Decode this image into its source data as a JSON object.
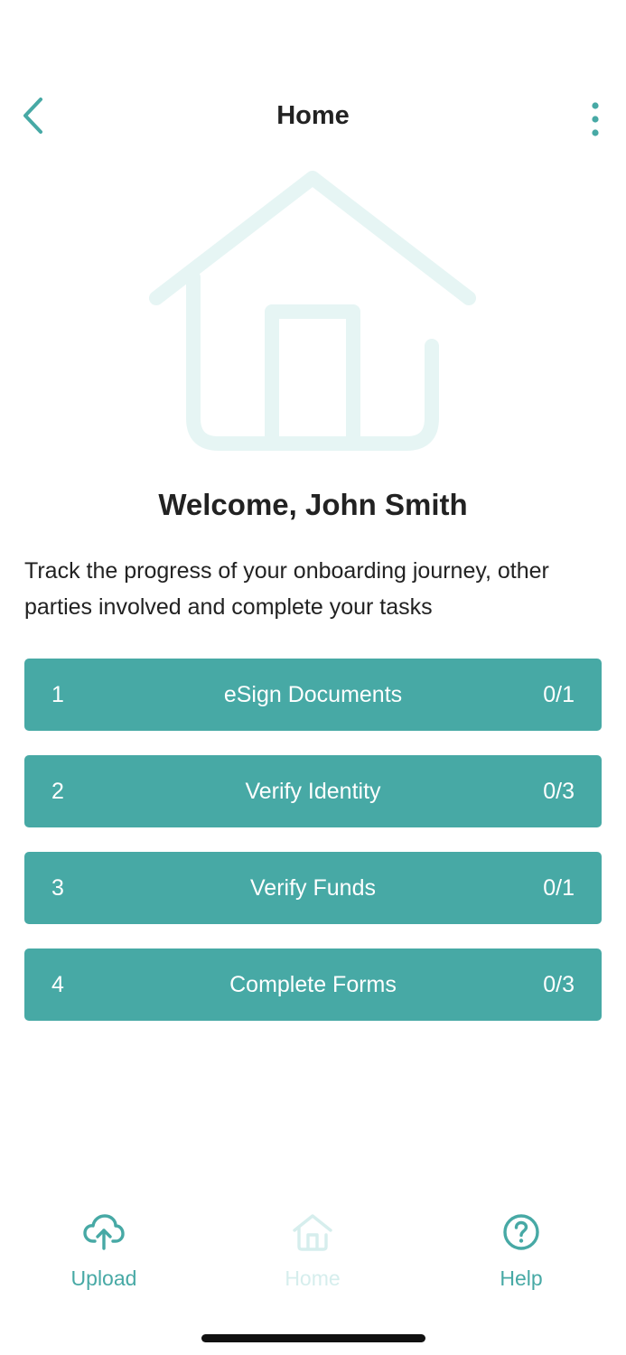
{
  "header": {
    "title": "Home",
    "back_icon": "chevron-left-icon",
    "more_icon": "more-vertical-icon"
  },
  "hero": {
    "icon": "house-illustration"
  },
  "welcome": {
    "title": "Welcome, John Smith",
    "description": "Track the progress of your onboarding journey, other parties involved and complete your tasks"
  },
  "tasks": [
    {
      "number": "1",
      "label": "eSign Documents",
      "progress": "0/1"
    },
    {
      "number": "2",
      "label": "Verify Identity",
      "progress": "0/3"
    },
    {
      "number": "3",
      "label": "Verify Funds",
      "progress": "0/1"
    },
    {
      "number": "4",
      "label": "Complete Forms",
      "progress": "0/3"
    }
  ],
  "bottom_nav": {
    "upload": {
      "label": "Upload",
      "icon": "cloud-upload-icon"
    },
    "home": {
      "label": "Home",
      "icon": "home-icon",
      "state": "active"
    },
    "help": {
      "label": "Help",
      "icon": "help-circle-icon"
    }
  },
  "colors": {
    "accent": "#47a9a5",
    "accent_light": "#e6f5f4",
    "text": "#222222",
    "background": "#ffffff"
  }
}
